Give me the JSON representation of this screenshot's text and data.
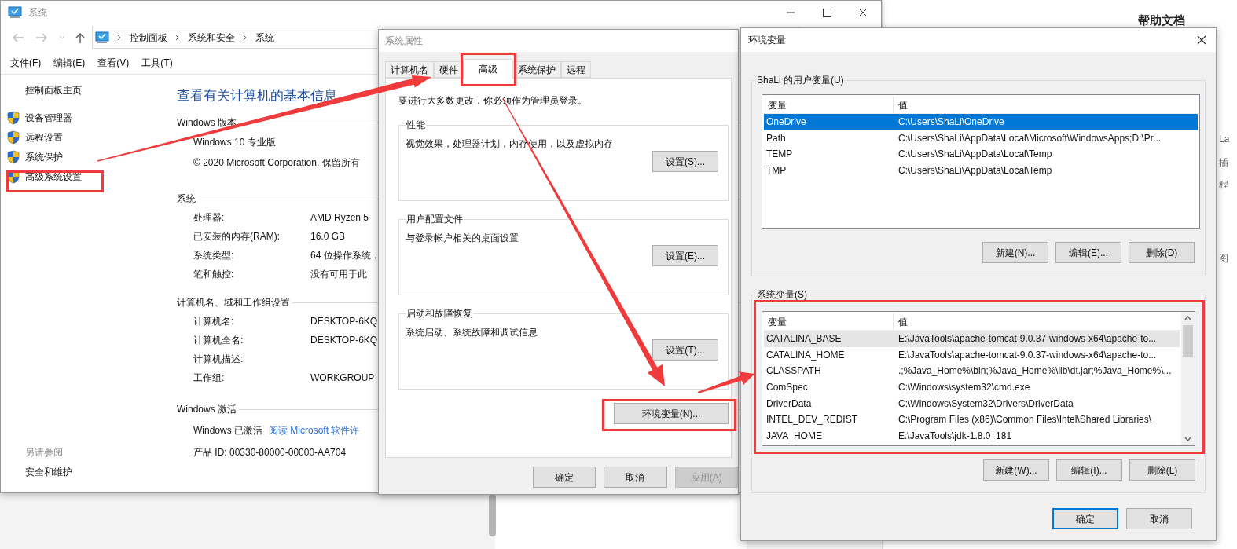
{
  "system_window": {
    "title": "系统",
    "breadcrumb": [
      "控制面板",
      "系统和安全",
      "系统"
    ],
    "menu": [
      "文件(F)",
      "编辑(E)",
      "查看(V)",
      "工具(T)"
    ],
    "sidebar": {
      "home": "控制面板主页",
      "links": [
        "设备管理器",
        "远程设置",
        "系统保护",
        "高级系统设置"
      ],
      "see_also_title": "另请参阅",
      "see_also": [
        "安全和维护"
      ]
    },
    "heading": "查看有关计算机的基本信息",
    "sections": [
      {
        "title": "Windows 版本",
        "items": [
          {
            "kind": "line",
            "text": "Windows 10 专业版"
          },
          {
            "kind": "line",
            "text": "© 2020 Microsoft Corporation. 保留所有"
          }
        ]
      },
      {
        "title": "系统",
        "items": [
          {
            "kind": "pair",
            "label": "处理器:",
            "value": "AMD Ryzen 5"
          },
          {
            "kind": "pair",
            "label": "已安装的内存(RAM):",
            "value": "16.0 GB"
          },
          {
            "kind": "pair",
            "label": "系统类型:",
            "value": "64 位操作系统，"
          },
          {
            "kind": "pair",
            "label": "笔和触控:",
            "value": "没有可用于此"
          }
        ]
      },
      {
        "title": "计算机名、域和工作组设置",
        "items": [
          {
            "kind": "pair",
            "label": "计算机名:",
            "value": "DESKTOP-6KQ"
          },
          {
            "kind": "pair",
            "label": "计算机全名:",
            "value": "DESKTOP-6KQ"
          },
          {
            "kind": "pair",
            "label": "计算机描述:"
          },
          {
            "kind": "pair",
            "label": "工作组:",
            "value": "WORKGROUP"
          }
        ]
      },
      {
        "title": "Windows 激活",
        "items": [
          {
            "kind": "status",
            "text": "Windows 已激活",
            "link": "阅读 Microsoft 软件许"
          },
          {
            "kind": "line",
            "text": "产品 ID: 00330-80000-00000-AA704"
          }
        ]
      }
    ]
  },
  "system_properties": {
    "title": "系统属性",
    "tabs": [
      {
        "label": "计算机名",
        "selected": false
      },
      {
        "label": "硬件",
        "selected": false
      },
      {
        "label": "高级",
        "selected": true
      },
      {
        "label": "系统保护",
        "selected": false
      },
      {
        "label": "远程",
        "selected": false
      }
    ],
    "notice": "要进行大多数更改，你必须作为管理员登录。",
    "groups": [
      {
        "title": "性能",
        "description": "视觉效果，处理器计划，内存使用，以及虚拟内存",
        "button": "设置(S)..."
      },
      {
        "title": "用户配置文件",
        "description": "与登录帐户相关的桌面设置",
        "button": "设置(E)..."
      },
      {
        "title": "启动和故障恢复",
        "description": "系统启动、系统故障和调试信息",
        "button": "设置(T)..."
      }
    ],
    "env_button": "环境变量(N)...",
    "buttons": [
      {
        "label": "确定",
        "disabled": false
      },
      {
        "label": "取消",
        "disabled": false
      },
      {
        "label": "应用(A)",
        "disabled": true
      }
    ]
  },
  "env_dialog": {
    "title": "环境变量",
    "user_vars": {
      "title": "ShaLi 的用户变量(U)",
      "columns": [
        "变量",
        "值"
      ],
      "rows": [
        {
          "name": "OneDrive",
          "value": "C:\\Users\\ShaLi\\OneDrive",
          "selected": true
        },
        {
          "name": "Path",
          "value": "C:\\Users\\ShaLi\\AppData\\Local\\Microsoft\\WindowsApps;D:\\Pr...",
          "selected": false
        },
        {
          "name": "TEMP",
          "value": "C:\\Users\\ShaLi\\AppData\\Local\\Temp",
          "selected": false
        },
        {
          "name": "TMP",
          "value": "C:\\Users\\ShaLi\\AppData\\Local\\Temp",
          "selected": false
        }
      ],
      "buttons": [
        "新建(N)...",
        "编辑(E)...",
        "删除(D)"
      ]
    },
    "system_vars": {
      "title": "系统变量(S)",
      "columns": [
        "变量",
        "值"
      ],
      "rows": [
        {
          "name": "CATALINA_BASE",
          "value": "E:\\JavaTools\\apache-tomcat-9.0.37-windows-x64\\apache-to...",
          "selected": false,
          "hover": true
        },
        {
          "name": "CATALINA_HOME",
          "value": "E:\\JavaTools\\apache-tomcat-9.0.37-windows-x64\\apache-to...",
          "selected": false,
          "hover": false
        },
        {
          "name": "CLASSPATH",
          "value": ".;%Java_Home%\\bin;%Java_Home%\\lib\\dt.jar;%Java_Home%\\...",
          "selected": false,
          "hover": false
        },
        {
          "name": "ComSpec",
          "value": "C:\\Windows\\system32\\cmd.exe",
          "selected": false,
          "hover": false
        },
        {
          "name": "DriverData",
          "value": "C:\\Windows\\System32\\Drivers\\DriverData",
          "selected": false,
          "hover": false
        },
        {
          "name": "INTEL_DEV_REDIST",
          "value": "C:\\Program Files (x86)\\Common Files\\Intel\\Shared Libraries\\",
          "selected": false,
          "hover": false
        },
        {
          "name": "JAVA_HOME",
          "value": "E:\\JavaTools\\jdk-1.8.0_181",
          "selected": false,
          "hover": false
        }
      ],
      "buttons": [
        "新建(W)...",
        "编辑(I)...",
        "删除(L)"
      ]
    },
    "buttons": [
      {
        "label": "确定",
        "default": true
      },
      {
        "label": "取消",
        "default": false
      }
    ]
  },
  "background_window": {
    "heading": "帮助文档",
    "fragments": [
      "La",
      "插",
      "程",
      "图"
    ]
  }
}
